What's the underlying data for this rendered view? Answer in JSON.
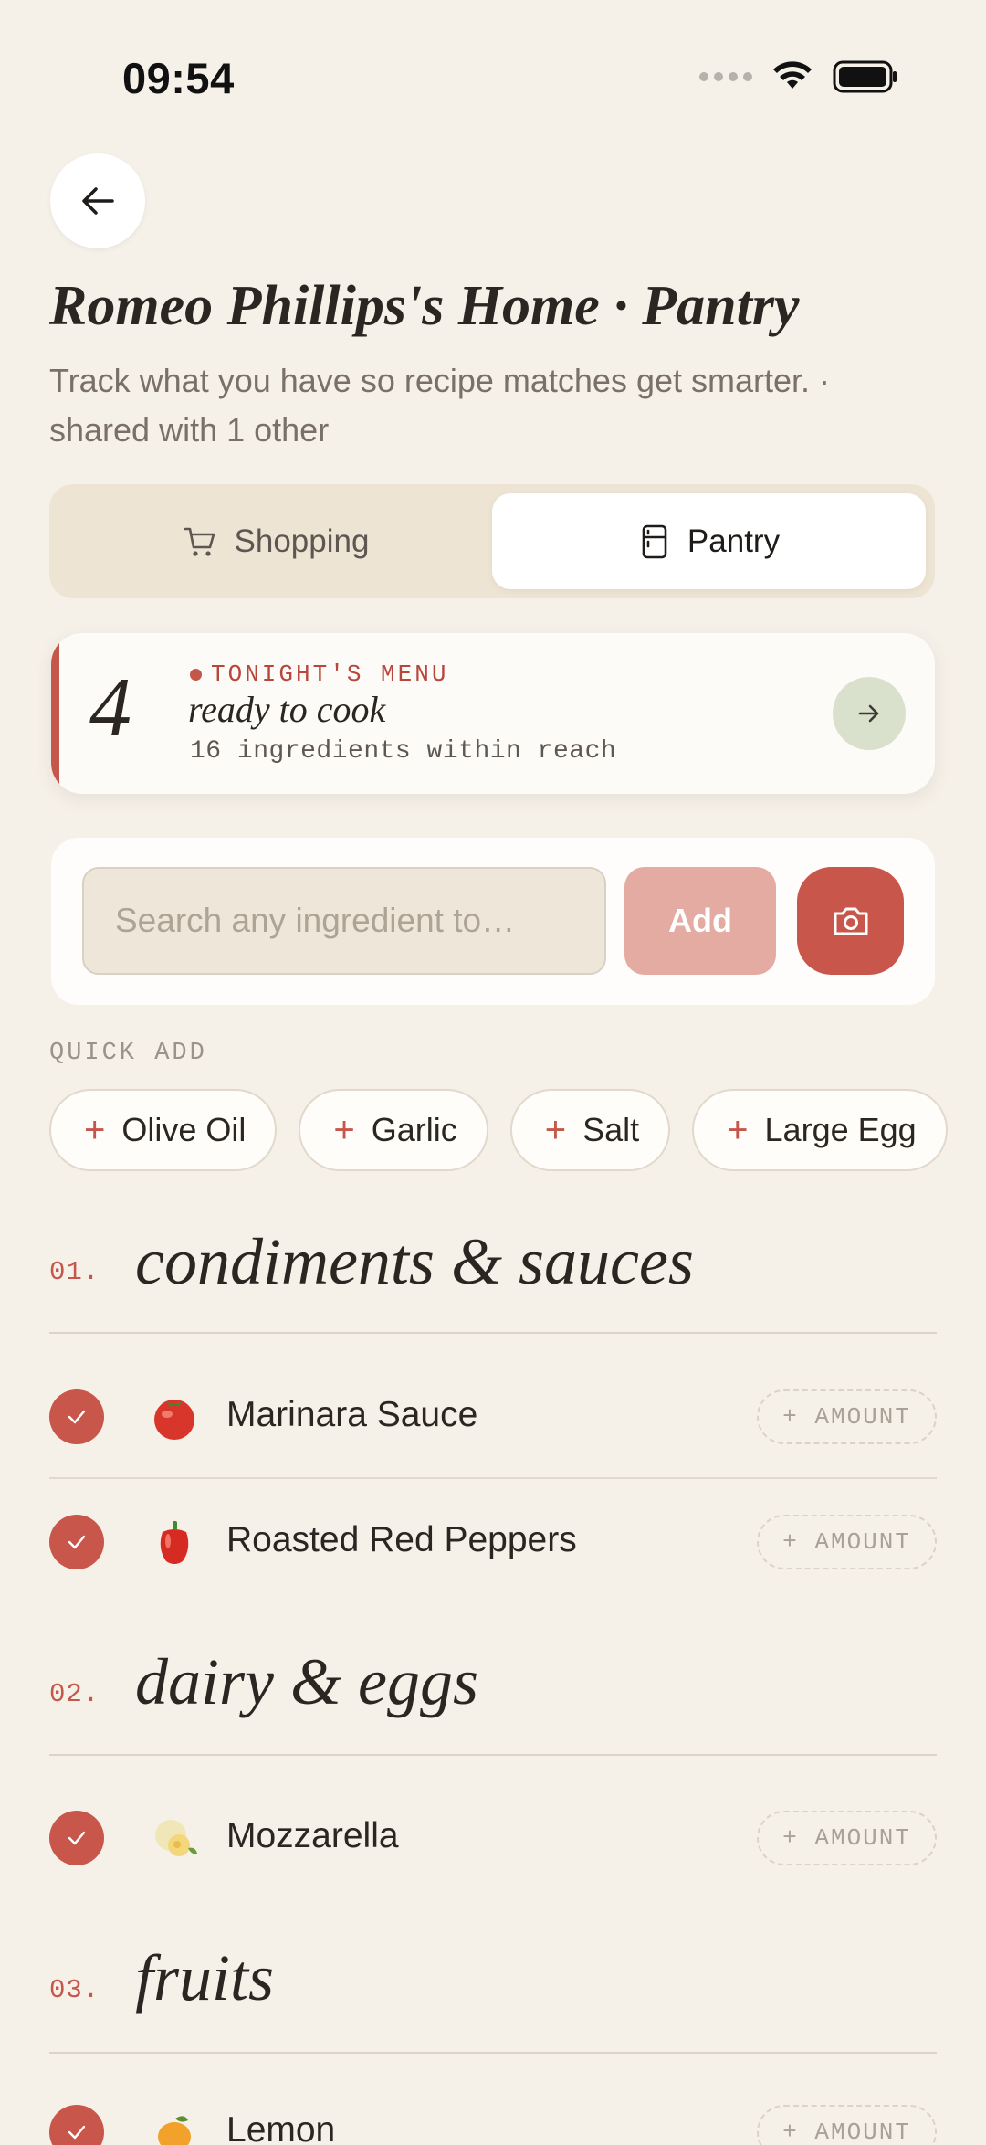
{
  "status": {
    "time": "09:54"
  },
  "header": {
    "title": "Romeo Phillips's Home · Pantry",
    "subtitle": "Track what you have so recipe matches get smarter. · shared with 1 other"
  },
  "tabs": [
    {
      "label": "Shopping",
      "icon": "cart-icon",
      "active": false
    },
    {
      "label": "Pantry",
      "icon": "fridge-icon",
      "active": true
    }
  ],
  "menu_card": {
    "count": "4",
    "kicker": "TONIGHT'S MENU",
    "headline": "ready to cook",
    "sub": "16 ingredients within reach"
  },
  "search": {
    "placeholder": "Search any ingredient to…",
    "add_label": "Add"
  },
  "quick_add": {
    "label": "QUICK ADD",
    "items": [
      "Olive Oil",
      "Garlic",
      "Salt",
      "Large Egg"
    ]
  },
  "amount_label": "+ AMOUNT",
  "sections": [
    {
      "num": "01.",
      "name": "condiments & sauces",
      "items": [
        {
          "name": "Marinara Sauce",
          "emoji": "🍅",
          "checked": true
        },
        {
          "name": "Roasted Red Peppers",
          "emoji": "🫑",
          "checked": true
        }
      ]
    },
    {
      "num": "02.",
      "name": "dairy & eggs",
      "items": [
        {
          "name": "Mozzarella",
          "emoji": "🧀",
          "checked": true
        }
      ]
    },
    {
      "num": "03.",
      "name": "fruits",
      "items": [
        {
          "name": "Lemon",
          "emoji": "🍋",
          "checked": true
        }
      ]
    }
  ],
  "colors": {
    "background": "#f5f0e8",
    "accent": "#c9564a",
    "accent_light": "#e4aba2",
    "go_button": "#d9e1cc"
  }
}
